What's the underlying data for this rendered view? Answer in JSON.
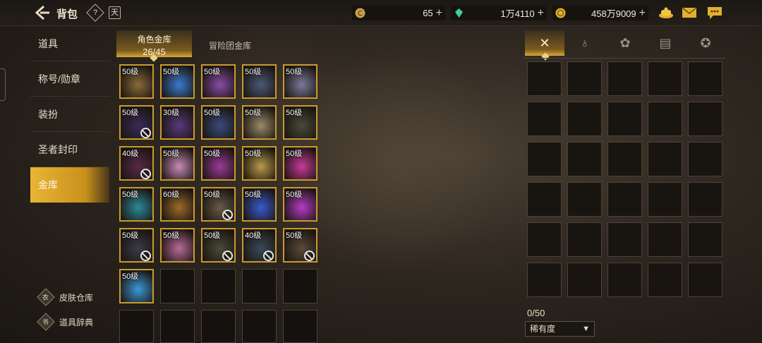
{
  "header": {
    "title": "背包",
    "help_icon": "?",
    "calendar_icon": "天",
    "currencies": [
      {
        "icon": "coin-c-icon",
        "value": "65"
      },
      {
        "icon": "gem-icon",
        "value": "1万4110"
      },
      {
        "icon": "gold-icon",
        "value": "458万9009"
      }
    ],
    "plus": "+"
  },
  "nav": {
    "items": [
      {
        "label": "道具",
        "active": false
      },
      {
        "label": "称号/勋章",
        "active": false
      },
      {
        "label": "装扮",
        "active": false
      },
      {
        "label": "圣者封印",
        "active": false
      },
      {
        "label": "金库",
        "active": true
      }
    ],
    "bottom_links": [
      {
        "label": "皮肤仓库",
        "icon": "wardrobe-icon",
        "glyph": "衣"
      },
      {
        "label": "道具辞典",
        "icon": "book-icon",
        "glyph": "书"
      }
    ]
  },
  "vault": {
    "tabs": [
      {
        "label": "角色金库",
        "count": "26/45",
        "active": true
      },
      {
        "label": "冒险团金库",
        "active": false
      }
    ],
    "items": [
      {
        "level": "50级",
        "color": "#8a6a3a",
        "locked": false
      },
      {
        "level": "50级",
        "color": "#3a7ad0",
        "locked": false
      },
      {
        "level": "50级",
        "color": "#8a4aa8",
        "locked": false
      },
      {
        "level": "50级",
        "color": "#4a5a78",
        "locked": false
      },
      {
        "level": "50级",
        "color": "#7a7a9a",
        "locked": false
      },
      {
        "level": "50级",
        "color": "#3a2a5a",
        "locked": true
      },
      {
        "level": "30级",
        "color": "#5a3a7a",
        "locked": false
      },
      {
        "level": "50级",
        "color": "#3a4a7a",
        "locked": false
      },
      {
        "level": "50级",
        "color": "#9a8a6a",
        "locked": false
      },
      {
        "level": "50级",
        "color": "#4a4a3a",
        "locked": false
      },
      {
        "level": "40级",
        "color": "#5a2a4a",
        "locked": true
      },
      {
        "level": "50级",
        "color": "#c88ab8",
        "locked": false
      },
      {
        "level": "50级",
        "color": "#9a3a9a",
        "locked": false
      },
      {
        "level": "50级",
        "color": "#b89a4a",
        "locked": false
      },
      {
        "level": "50级",
        "color": "#c83a9a",
        "locked": false
      },
      {
        "level": "50级",
        "color": "#2a8a9a",
        "locked": false
      },
      {
        "level": "60级",
        "color": "#9a6a2a",
        "locked": false
      },
      {
        "level": "50级",
        "color": "#6a5a4a",
        "locked": true
      },
      {
        "level": "50级",
        "color": "#3a5ad0",
        "locked": false
      },
      {
        "level": "50级",
        "color": "#b83ac8",
        "locked": false
      },
      {
        "level": "50级",
        "color": "#3a3a4a",
        "locked": true
      },
      {
        "level": "50级",
        "color": "#b86a9a",
        "locked": false
      },
      {
        "level": "50级",
        "color": "#4a4a3a",
        "locked": true
      },
      {
        "level": "40级",
        "color": "#3a4a5a",
        "locked": true
      },
      {
        "level": "50级",
        "color": "#5a4a3a",
        "locked": true
      },
      {
        "level": "50级",
        "color": "#3a9ad8",
        "locked": false
      }
    ]
  },
  "right_panel": {
    "tabs": [
      {
        "icon": "armor-icon",
        "glyph": "✕",
        "active": true
      },
      {
        "icon": "potion-icon",
        "glyph": "♁",
        "active": false
      },
      {
        "icon": "material-icon",
        "glyph": "✿",
        "active": false
      },
      {
        "icon": "card-icon",
        "glyph": "▤",
        "active": false
      },
      {
        "icon": "star-icon",
        "glyph": "✪",
        "active": false
      }
    ],
    "count": "0/50",
    "sort": {
      "selected": "稀有度",
      "caret": "▼"
    }
  }
}
